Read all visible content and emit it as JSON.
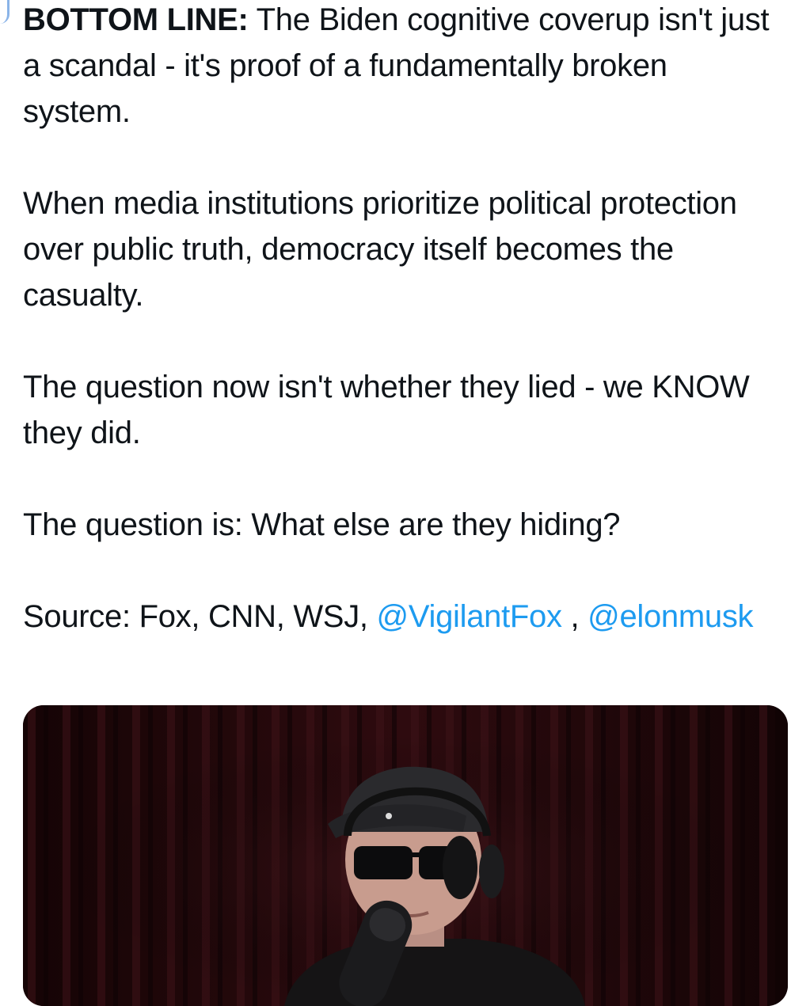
{
  "tweet": {
    "paragraphs": [
      {
        "bold_lead": "BOTTOM LINE:",
        "text": " The Biden cognitive coverup isn't just a scandal - it's proof of a fundamentally broken system."
      },
      {
        "text": "When media institutions prioritize political protection over public truth, democracy itself becomes the casualty."
      },
      {
        "text": "The question now isn't whether they lied - we KNOW they did."
      },
      {
        "text": "The question is: What else are they hiding?"
      }
    ],
    "source": {
      "prefix": "Source: Fox, CNN, WSJ, ",
      "mention_1": "@VigilantFox",
      "separator": " , ",
      "mention_2": "@elonmusk"
    }
  },
  "media": {
    "kind": "video-still",
    "subject": "person-in-cap-sunglasses-headphones-at-microphone"
  },
  "colors": {
    "text": "#0f1419",
    "link": "#1d9bf0",
    "thread_line": "#8ab4e8",
    "curtain": "#2a0a0d"
  }
}
